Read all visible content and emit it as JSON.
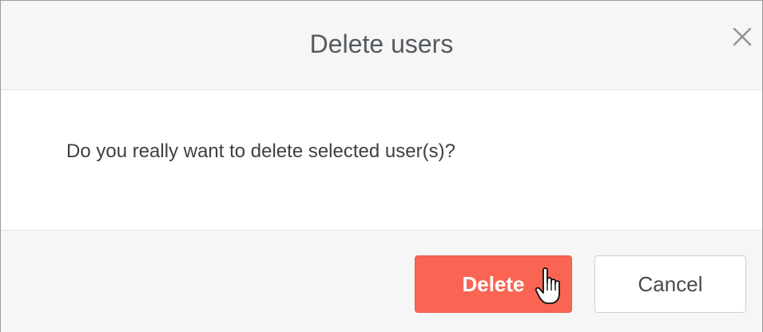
{
  "dialog": {
    "title": "Delete users",
    "message": "Do you really want to delete selected user(s)?",
    "close_icon": "close-icon",
    "buttons": {
      "delete_label": "Delete",
      "cancel_label": "Cancel"
    },
    "colors": {
      "delete_bg": "#fa6553",
      "header_bg": "#f6f6f6"
    }
  },
  "cursor": {
    "icon": "hand-pointer-icon"
  }
}
